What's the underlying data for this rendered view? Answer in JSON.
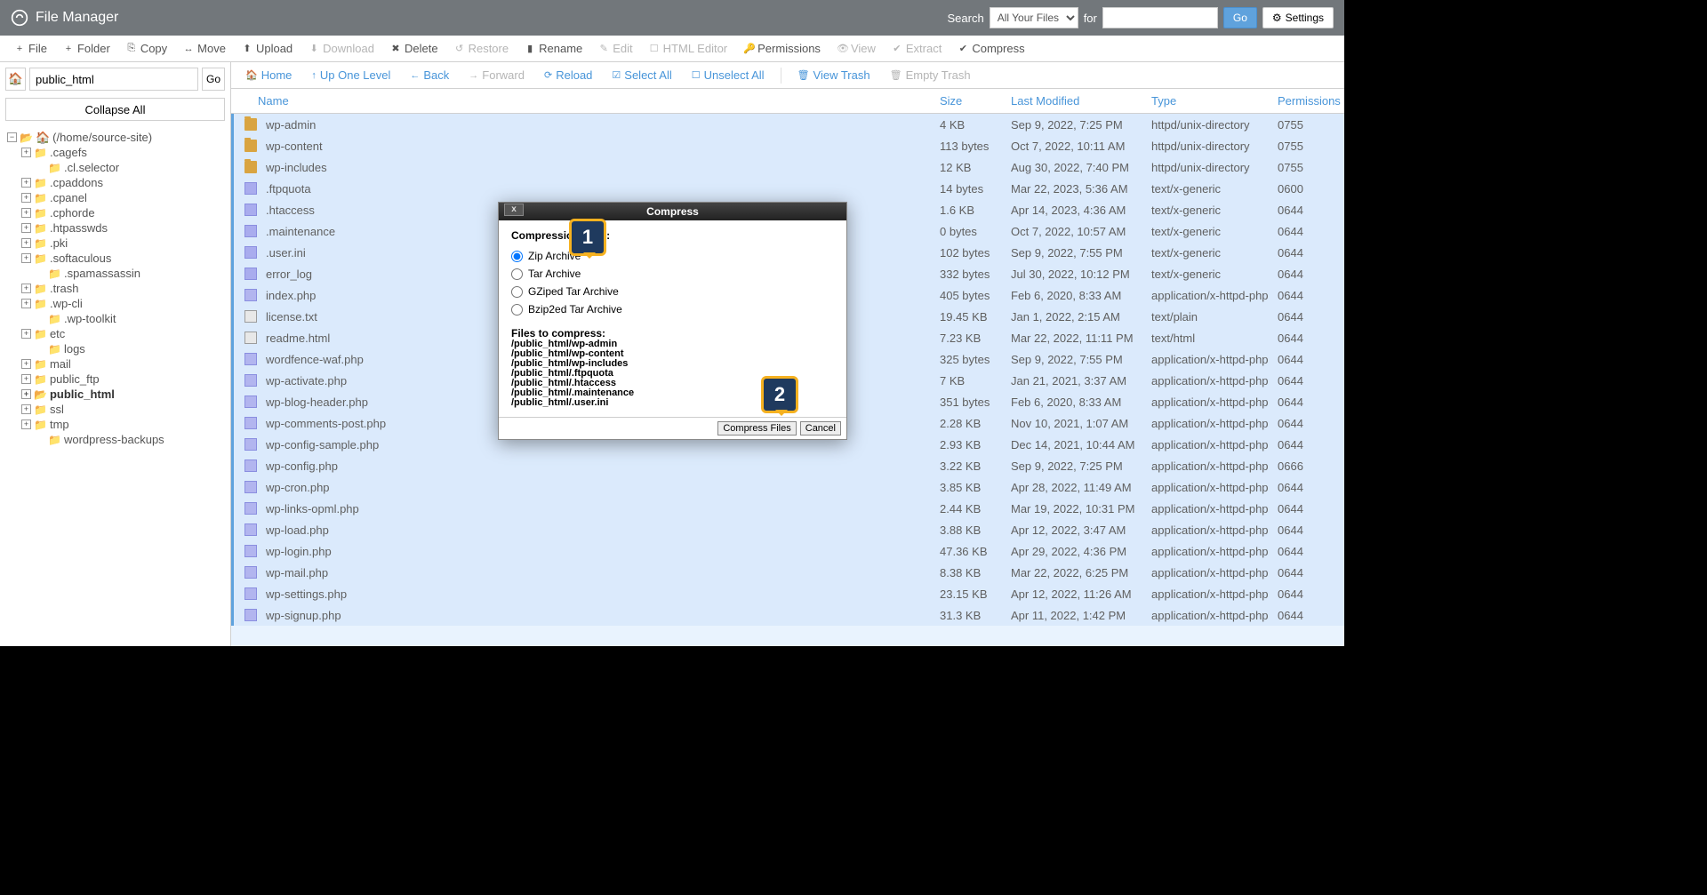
{
  "header": {
    "app_title": "File Manager",
    "search_label": "Search",
    "search_scope": "All Your Files",
    "for_label": "for",
    "go": "Go",
    "settings": "Settings"
  },
  "toolbar": [
    {
      "icon": "+",
      "label": "File",
      "name": "new-file",
      "disabled": false
    },
    {
      "icon": "+",
      "label": "Folder",
      "name": "new-folder",
      "disabled": false
    },
    {
      "icon": "⎘",
      "label": "Copy",
      "name": "copy",
      "disabled": false
    },
    {
      "icon": "↔",
      "label": "Move",
      "name": "move",
      "disabled": false
    },
    {
      "icon": "⬆",
      "label": "Upload",
      "name": "upload",
      "disabled": false
    },
    {
      "icon": "⬇",
      "label": "Download",
      "name": "download",
      "disabled": true
    },
    {
      "icon": "✖",
      "label": "Delete",
      "name": "delete",
      "disabled": false
    },
    {
      "icon": "↺",
      "label": "Restore",
      "name": "restore",
      "disabled": true
    },
    {
      "icon": "▮",
      "label": "Rename",
      "name": "rename",
      "disabled": false
    },
    {
      "icon": "✎",
      "label": "Edit",
      "name": "edit",
      "disabled": true
    },
    {
      "icon": "☐",
      "label": "HTML Editor",
      "name": "html-editor",
      "disabled": true
    },
    {
      "icon": "🔑",
      "label": "Permissions",
      "name": "permissions",
      "disabled": false
    },
    {
      "icon": "👁",
      "label": "View",
      "name": "view",
      "disabled": true
    },
    {
      "icon": "✔",
      "label": "Extract",
      "name": "extract",
      "disabled": true
    },
    {
      "icon": "✔",
      "label": "Compress",
      "name": "compress",
      "disabled": false
    }
  ],
  "sidebar": {
    "path_value": "public_html",
    "go": "Go",
    "collapse": "Collapse All",
    "root_label": "(/home/source-site)",
    "tree": [
      {
        "label": ".cagefs",
        "ind": 1,
        "exp": "+"
      },
      {
        "label": ".cl.selector",
        "ind": 2,
        "exp": ""
      },
      {
        "label": ".cpaddons",
        "ind": 1,
        "exp": "+"
      },
      {
        "label": ".cpanel",
        "ind": 1,
        "exp": "+"
      },
      {
        "label": ".cphorde",
        "ind": 1,
        "exp": "+"
      },
      {
        "label": ".htpasswds",
        "ind": 1,
        "exp": "+"
      },
      {
        "label": ".pki",
        "ind": 1,
        "exp": "+"
      },
      {
        "label": ".softaculous",
        "ind": 1,
        "exp": "+"
      },
      {
        "label": ".spamassassin",
        "ind": 2,
        "exp": ""
      },
      {
        "label": ".trash",
        "ind": 1,
        "exp": "+"
      },
      {
        "label": ".wp-cli",
        "ind": 1,
        "exp": "+"
      },
      {
        "label": ".wp-toolkit",
        "ind": 2,
        "exp": ""
      },
      {
        "label": "etc",
        "ind": 1,
        "exp": "+"
      },
      {
        "label": "logs",
        "ind": 2,
        "exp": ""
      },
      {
        "label": "mail",
        "ind": 1,
        "exp": "+"
      },
      {
        "label": "public_ftp",
        "ind": 1,
        "exp": "+"
      },
      {
        "label": "public_html",
        "ind": 1,
        "exp": "+",
        "selected": true
      },
      {
        "label": "ssl",
        "ind": 1,
        "exp": "+"
      },
      {
        "label": "tmp",
        "ind": 1,
        "exp": "+"
      },
      {
        "label": "wordpress-backups",
        "ind": 2,
        "exp": ""
      }
    ]
  },
  "actionbar": {
    "home": "Home",
    "up": "Up One Level",
    "back": "Back",
    "forward": "Forward",
    "reload": "Reload",
    "select_all": "Select All",
    "unselect_all": "Unselect All",
    "view_trash": "View Trash",
    "empty_trash": "Empty Trash"
  },
  "columns": {
    "name": "Name",
    "size": "Size",
    "modified": "Last Modified",
    "type": "Type",
    "perms": "Permissions"
  },
  "files": [
    {
      "icon": "folder",
      "name": "wp-admin",
      "size": "4 KB",
      "mod": "Sep 9, 2022, 7:25 PM",
      "type": "httpd/unix-directory",
      "perm": "0755"
    },
    {
      "icon": "folder",
      "name": "wp-content",
      "size": "113 bytes",
      "mod": "Oct 7, 2022, 10:11 AM",
      "type": "httpd/unix-directory",
      "perm": "0755"
    },
    {
      "icon": "folder",
      "name": "wp-includes",
      "size": "12 KB",
      "mod": "Aug 30, 2022, 7:40 PM",
      "type": "httpd/unix-directory",
      "perm": "0755"
    },
    {
      "icon": "txt",
      "name": ".ftpquota",
      "size": "14 bytes",
      "mod": "Mar 22, 2023, 5:36 AM",
      "type": "text/x-generic",
      "perm": "0600"
    },
    {
      "icon": "txt",
      "name": ".htaccess",
      "size": "1.6 KB",
      "mod": "Apr 14, 2023, 4:36 AM",
      "type": "text/x-generic",
      "perm": "0644"
    },
    {
      "icon": "txt",
      "name": ".maintenance",
      "size": "0 bytes",
      "mod": "Oct 7, 2022, 10:57 AM",
      "type": "text/x-generic",
      "perm": "0644"
    },
    {
      "icon": "txt",
      "name": ".user.ini",
      "size": "102 bytes",
      "mod": "Sep 9, 2022, 7:55 PM",
      "type": "text/x-generic",
      "perm": "0644"
    },
    {
      "icon": "txt",
      "name": "error_log",
      "size": "332 bytes",
      "mod": "Jul 30, 2022, 10:12 PM",
      "type": "text/x-generic",
      "perm": "0644"
    },
    {
      "icon": "php",
      "name": "index.php",
      "size": "405 bytes",
      "mod": "Feb 6, 2020, 8:33 AM",
      "type": "application/x-httpd-php",
      "perm": "0644"
    },
    {
      "icon": "gen",
      "name": "license.txt",
      "size": "19.45 KB",
      "mod": "Jan 1, 2022, 2:15 AM",
      "type": "text/plain",
      "perm": "0644"
    },
    {
      "icon": "gen",
      "name": "readme.html",
      "size": "7.23 KB",
      "mod": "Mar 22, 2022, 11:11 PM",
      "type": "text/html",
      "perm": "0644"
    },
    {
      "icon": "php",
      "name": "wordfence-waf.php",
      "size": "325 bytes",
      "mod": "Sep 9, 2022, 7:55 PM",
      "type": "application/x-httpd-php",
      "perm": "0644"
    },
    {
      "icon": "php",
      "name": "wp-activate.php",
      "size": "7 KB",
      "mod": "Jan 21, 2021, 3:37 AM",
      "type": "application/x-httpd-php",
      "perm": "0644"
    },
    {
      "icon": "php",
      "name": "wp-blog-header.php",
      "size": "351 bytes",
      "mod": "Feb 6, 2020, 8:33 AM",
      "type": "application/x-httpd-php",
      "perm": "0644"
    },
    {
      "icon": "php",
      "name": "wp-comments-post.php",
      "size": "2.28 KB",
      "mod": "Nov 10, 2021, 1:07 AM",
      "type": "application/x-httpd-php",
      "perm": "0644"
    },
    {
      "icon": "php",
      "name": "wp-config-sample.php",
      "size": "2.93 KB",
      "mod": "Dec 14, 2021, 10:44 AM",
      "type": "application/x-httpd-php",
      "perm": "0644"
    },
    {
      "icon": "php",
      "name": "wp-config.php",
      "size": "3.22 KB",
      "mod": "Sep 9, 2022, 7:25 PM",
      "type": "application/x-httpd-php",
      "perm": "0666"
    },
    {
      "icon": "php",
      "name": "wp-cron.php",
      "size": "3.85 KB",
      "mod": "Apr 28, 2022, 11:49 AM",
      "type": "application/x-httpd-php",
      "perm": "0644"
    },
    {
      "icon": "php",
      "name": "wp-links-opml.php",
      "size": "2.44 KB",
      "mod": "Mar 19, 2022, 10:31 PM",
      "type": "application/x-httpd-php",
      "perm": "0644"
    },
    {
      "icon": "php",
      "name": "wp-load.php",
      "size": "3.88 KB",
      "mod": "Apr 12, 2022, 3:47 AM",
      "type": "application/x-httpd-php",
      "perm": "0644"
    },
    {
      "icon": "php",
      "name": "wp-login.php",
      "size": "47.36 KB",
      "mod": "Apr 29, 2022, 4:36 PM",
      "type": "application/x-httpd-php",
      "perm": "0644"
    },
    {
      "icon": "php",
      "name": "wp-mail.php",
      "size": "8.38 KB",
      "mod": "Mar 22, 2022, 6:25 PM",
      "type": "application/x-httpd-php",
      "perm": "0644"
    },
    {
      "icon": "php",
      "name": "wp-settings.php",
      "size": "23.15 KB",
      "mod": "Apr 12, 2022, 11:26 AM",
      "type": "application/x-httpd-php",
      "perm": "0644"
    },
    {
      "icon": "php",
      "name": "wp-signup.php",
      "size": "31.3 KB",
      "mod": "Apr 11, 2022, 1:42 PM",
      "type": "application/x-httpd-php",
      "perm": "0644"
    }
  ],
  "modal": {
    "title": "Compress",
    "type_label": "Compression Type:",
    "options": [
      "Zip Archive",
      "Tar Archive",
      "GZiped Tar Archive",
      "Bzip2ed Tar Archive"
    ],
    "selected": 0,
    "files_label": "Files to compress:",
    "files": [
      "/public_html/wp-admin",
      "/public_html/wp-content",
      "/public_html/wp-includes",
      "/public_html/.ftpquota",
      "/public_html/.htaccess",
      "/public_html/.maintenance",
      "/public_html/.user.ini"
    ],
    "compress_btn": "Compress Files",
    "cancel_btn": "Cancel"
  },
  "callouts": {
    "one": "1",
    "two": "2"
  }
}
